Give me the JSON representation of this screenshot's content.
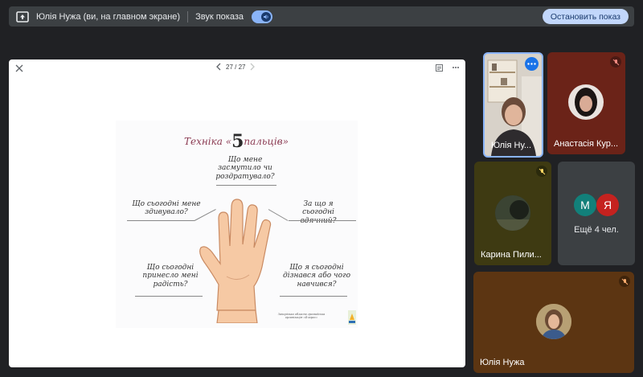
{
  "present_bar": {
    "presenter_label": "Юлія Нужа (ви, на главном экране)",
    "sound_label": "Звук показа",
    "stop_label": "Остановить показ",
    "sound_enabled": true
  },
  "viewer": {
    "page_indicator": "27 / 27",
    "slide": {
      "title_prefix": "Техніка «",
      "title_number": "5",
      "title_suffix": "пальців»",
      "questions": [
        "Що мене засмутило чи роздратувало?",
        "Що сьогодні мене здивувало?",
        "За що я сьогодні вдячний?",
        "Що сьогодні принесло мені радість?",
        "Що я сьогодні дізнався або чого навчився?"
      ],
      "org_text": "Запорізька обласна громадська організація «Флорес»"
    }
  },
  "participants": [
    {
      "name": "Юлія Ну...",
      "has_video": true,
      "active": true
    },
    {
      "name": "Анастасія Кур...",
      "has_video": false,
      "muted": true
    },
    {
      "name": "Карина Пили...",
      "has_video": false,
      "muted": true
    },
    {
      "name": "Ещё 4 чел.",
      "initials": [
        "М",
        "Я"
      ],
      "initial_colors": [
        "#12807a",
        "#c5221f"
      ]
    },
    {
      "name": "Юлія Нужа",
      "has_video": false,
      "muted": true
    }
  ],
  "colors": {
    "accent_blue": "#8ab4f8",
    "stop_button_bg": "#c2d7fb",
    "mute_red": "#c5221f"
  }
}
